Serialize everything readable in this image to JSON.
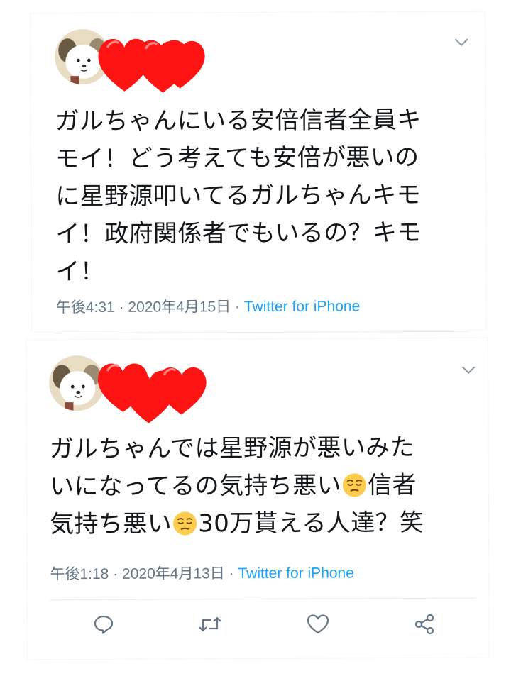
{
  "tweets": [
    {
      "text_lines": [
        "ガルちゃんにいる安倍信者全員キ",
        "モイ！どう考えても安倍が悪いの",
        "に星野源叩いてるガルちゃんキモ",
        "イ！政府関係者でもいるの？キモ",
        "イ！"
      ],
      "time": "午後4:31",
      "date": "2020年4月15日",
      "source": "Twitter for iPhone",
      "separator": "·"
    },
    {
      "text_line1": "ガルちゃんでは星野源が悪いみた",
      "text_line2_a": "いになってるの気持ち悪い",
      "text_line2_b": "信者",
      "text_line3_a": "気持ち悪い",
      "text_line3_b": "30万貰える人達？笑",
      "time": "午後1:18",
      "date": "2020年4月13日",
      "source": "Twitter for iPhone",
      "separator": "·"
    }
  ],
  "icons": {
    "menu": "chevron-down-icon",
    "reply": "reply-icon",
    "retweet": "retweet-icon",
    "like": "heart-icon",
    "share": "share-icon",
    "emoji": "pensive-face-emoji",
    "redaction": "red-heart-stickers"
  },
  "colors": {
    "text": "#14171a",
    "meta": "#657786",
    "link": "#1da1f2",
    "heart_sticker": "#ff1a1a",
    "divider": "#e6ecf0"
  }
}
